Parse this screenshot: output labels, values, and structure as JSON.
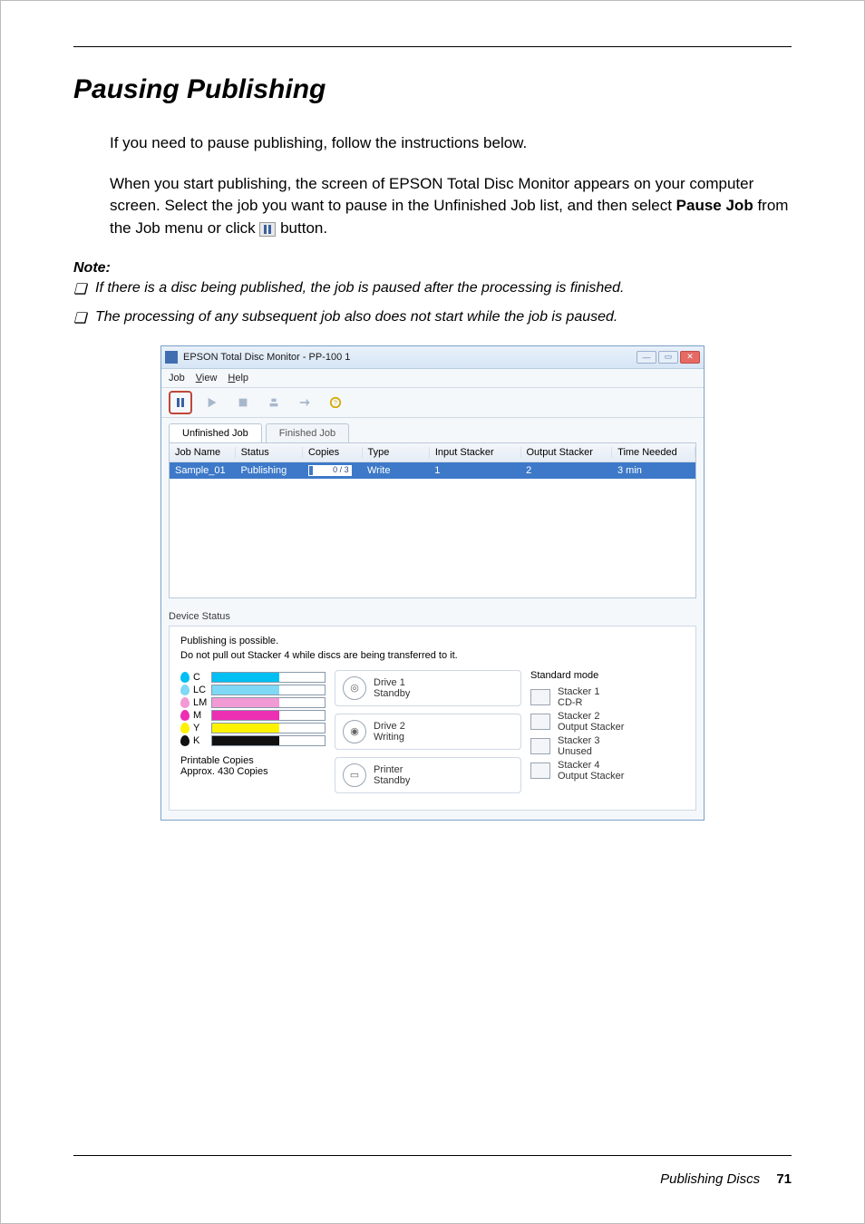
{
  "section": {
    "title": "Pausing Publishing",
    "intro": "If you need to pause publishing, follow the instructions below.",
    "para2a": "When you start publishing, the screen of EPSON Total Disc Monitor appears on your computer screen. Select the job you want to pause in the Unfinished Job list, and then select ",
    "pauseJob": "Pause Job",
    "para2b": " from the Job menu or click ",
    "para2c": " button.",
    "noteHead": "Note:",
    "notes": [
      "If there is a disc being published, the job is paused after the processing is finished.",
      "The processing of any subsequent job also does not start while the job is paused."
    ]
  },
  "footer": {
    "text": "Publishing Discs",
    "page": "71"
  },
  "win": {
    "title": "EPSON Total Disc Monitor - PP-100 1",
    "menu": {
      "job": "Job",
      "view": "View",
      "help": "Help"
    },
    "tabs": {
      "unfinished": "Unfinished Job",
      "finished": "Finished Job"
    },
    "cols": {
      "jobName": "Job Name",
      "status": "Status",
      "copies": "Copies",
      "type": "Type",
      "inputStacker": "Input Stacker",
      "outputStacker": "Output Stacker",
      "timeNeeded": "Time Needed"
    },
    "job": {
      "name": "Sample_01",
      "status": "Publishing",
      "copies": "0 / 3",
      "type": "Write",
      "input": "1",
      "output": "2",
      "time": "3 min"
    },
    "device": {
      "heading": "Device Status",
      "line1": "Publishing is possible.",
      "line2": "Do not pull out Stacker 4 while discs are being transferred to it."
    },
    "inks": [
      {
        "label": "C",
        "color": "#00bff3",
        "level": 60
      },
      {
        "label": "LC",
        "color": "#7fd8f5",
        "level": 60
      },
      {
        "label": "LM",
        "color": "#f29ad4",
        "level": 60
      },
      {
        "label": "M",
        "color": "#ec2fb3",
        "level": 60
      },
      {
        "label": "Y",
        "color": "#fff200",
        "level": 60
      },
      {
        "label": "K",
        "color": "#111111",
        "level": 60
      }
    ],
    "printable": {
      "l1": "Printable Copies",
      "l2": "Approx. 430 Copies"
    },
    "drives": [
      {
        "name": "Drive 1",
        "state": "Standby"
      },
      {
        "name": "Drive 2",
        "state": "Writing"
      },
      {
        "name": "Printer",
        "state": "Standby"
      }
    ],
    "mode": "Standard mode",
    "stackers": [
      {
        "name": "Stacker 1",
        "role": "CD-R"
      },
      {
        "name": "Stacker 2",
        "role": "Output Stacker"
      },
      {
        "name": "Stacker 3",
        "role": "Unused"
      },
      {
        "name": "Stacker 4",
        "role": "Output Stacker"
      }
    ]
  }
}
